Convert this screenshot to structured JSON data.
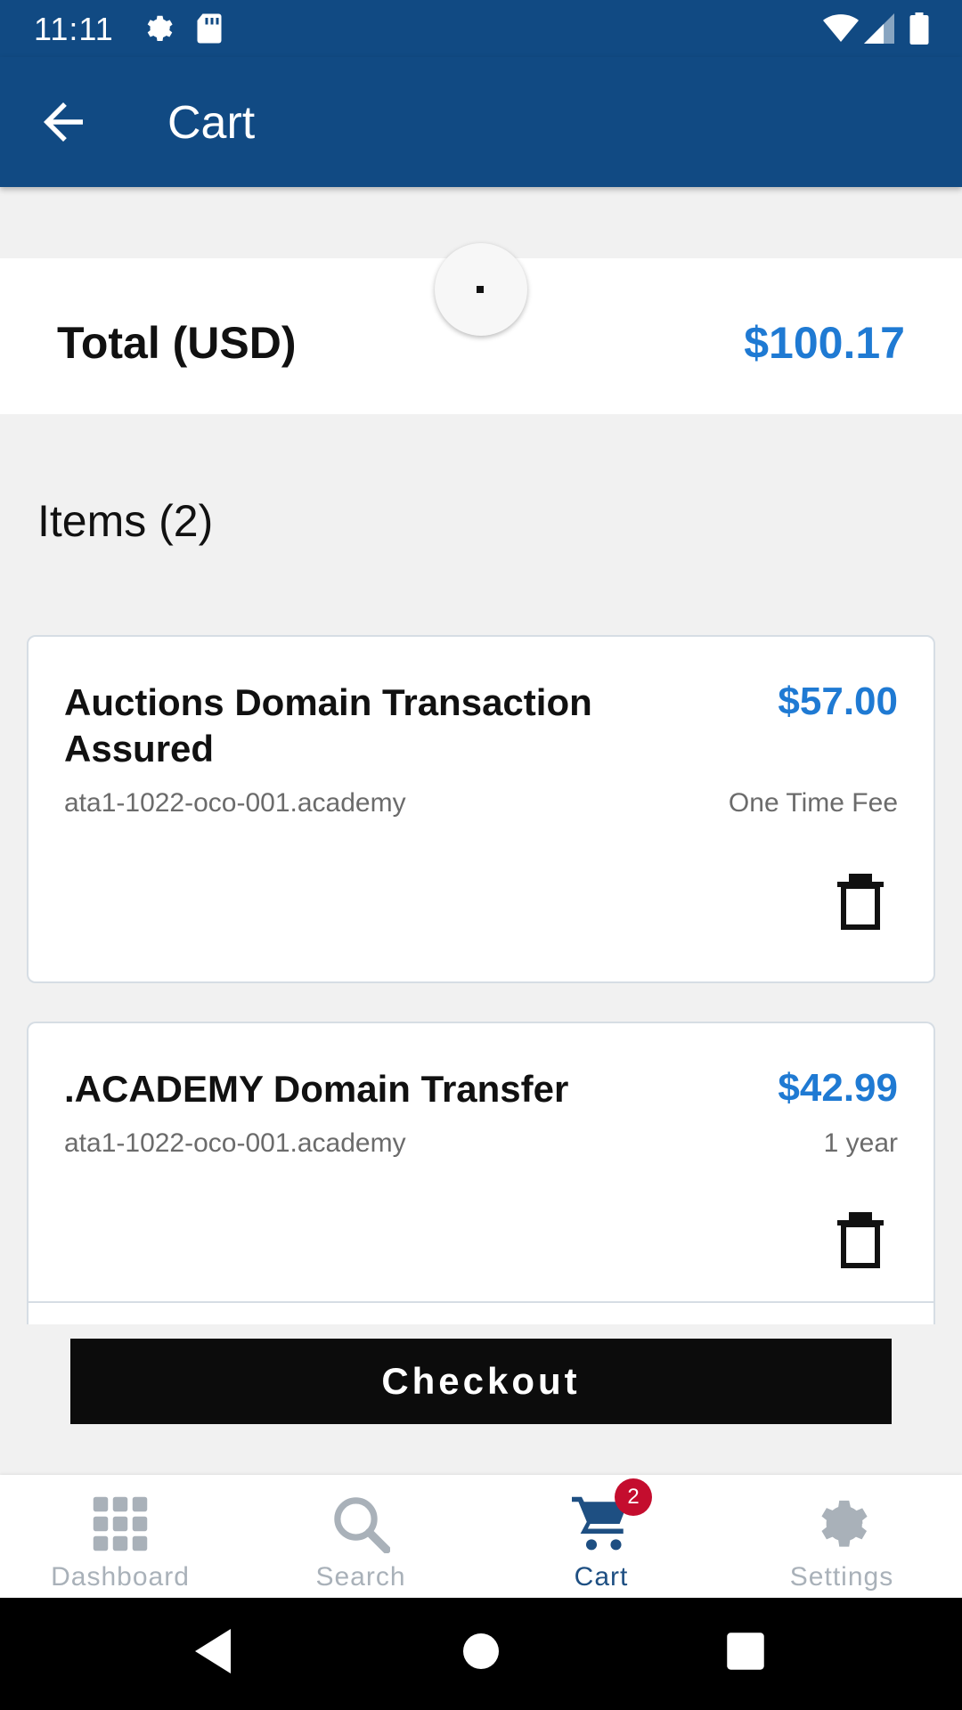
{
  "status_bar": {
    "time": "11:11",
    "icons": [
      "gear-icon",
      "sd-card-icon",
      "wifi-icon",
      "signal-icon",
      "battery-icon"
    ]
  },
  "app_bar": {
    "title": "Cart",
    "back_icon": "arrow-left-icon"
  },
  "total": {
    "label": "Total (USD)",
    "amount": "$100.17"
  },
  "items_heading": "Items (2)",
  "items": [
    {
      "name": "Auctions Domain Transaction Assured",
      "price": "$57.00",
      "domain": "ata1-1022-oco-001.academy",
      "term": "One Time Fee",
      "delete_icon": "trash-icon"
    },
    {
      "name": ".ACADEMY Domain Transfer",
      "price": "$42.99",
      "domain": "ata1-1022-oco-001.academy",
      "term": "1 year",
      "delete_icon": "trash-icon"
    }
  ],
  "checkout_label": "Checkout",
  "bottom_nav": [
    {
      "label": "Dashboard",
      "icon": "grid-icon",
      "active": false
    },
    {
      "label": "Search",
      "icon": "search-icon",
      "active": false
    },
    {
      "label": "Cart",
      "icon": "cart-icon",
      "active": true,
      "badge": "2"
    },
    {
      "label": "Settings",
      "icon": "gear-icon",
      "active": false
    }
  ],
  "colors": {
    "brand": "#114a83",
    "price": "#1f7ad3",
    "active_nav": "#1e4f82",
    "inactive_nav": "#a9b1b9",
    "badge": "#c40d2e"
  }
}
